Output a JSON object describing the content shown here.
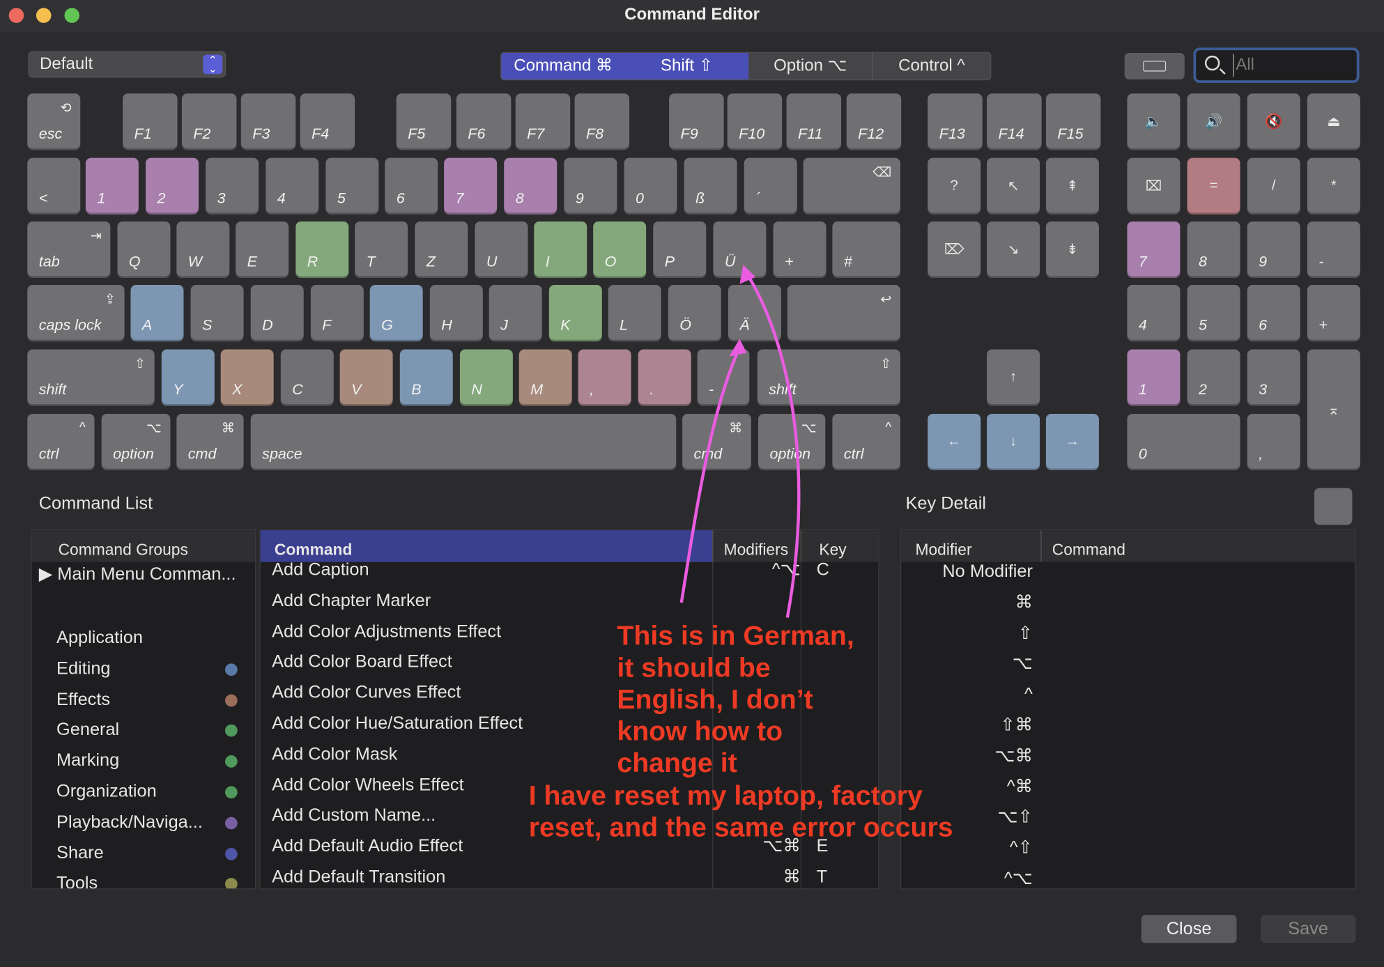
{
  "window": {
    "title": "Command Editor"
  },
  "toolbar": {
    "preset": "Default",
    "modifiers": [
      {
        "label": "Command ⌘",
        "active": true
      },
      {
        "label": "Shift ⇧",
        "active": true
      },
      {
        "label": "Option ⌥",
        "active": false
      },
      {
        "label": "Control ^",
        "active": false
      }
    ],
    "search_placeholder": "All"
  },
  "colors": {
    "purple": "#a87fad",
    "green": "#84a87b",
    "blue": "#7d97b3",
    "brown": "#a88a7c",
    "pink": "#ad8592",
    "red": "#b37b82",
    "key": "#707073",
    "accent": "#4a4fb8",
    "annotation": "#ee3a24"
  },
  "keyboard": {
    "fn_row": [
      "esc",
      "F1",
      "F2",
      "F3",
      "F4",
      "F5",
      "F6",
      "F7",
      "F8",
      "F9",
      "F10",
      "F11",
      "F12",
      "F13",
      "F14",
      "F15"
    ],
    "num_row": [
      "<",
      "1",
      "2",
      "3",
      "4",
      "5",
      "6",
      "7",
      "8",
      "9",
      "0",
      "ß",
      "´"
    ],
    "top_row": [
      "tab",
      "Q",
      "W",
      "E",
      "R",
      "T",
      "Z",
      "U",
      "I",
      "O",
      "P",
      "Ü",
      "+",
      "#"
    ],
    "home_row": [
      "caps lock",
      "A",
      "S",
      "D",
      "F",
      "G",
      "H",
      "J",
      "K",
      "L",
      "Ö",
      "Ä"
    ],
    "bottom_row": [
      "shift",
      "Y",
      "X",
      "C",
      "V",
      "B",
      "N",
      "M",
      ",",
      ".",
      "-",
      "shift"
    ],
    "space_row": [
      "ctrl",
      "option",
      "cmd",
      "space",
      "cmd",
      "option",
      "ctrl"
    ],
    "nav": [
      "?",
      "↖",
      "⇞",
      "⌦",
      "↘",
      "⇟",
      "↑",
      "←",
      "↓",
      "→"
    ],
    "numpad": [
      "⌧",
      "=",
      "/",
      "*",
      "7",
      "8",
      "9",
      "-",
      "4",
      "5",
      "6",
      "+",
      "1",
      "2",
      "3",
      "0",
      ",",
      "⌅"
    ],
    "media": [
      "🔈",
      "🔊",
      "🔇",
      "⏏"
    ]
  },
  "command_list": {
    "label": "Command List",
    "groups_header": "Command Groups",
    "groups": [
      {
        "name": "▶  Main Menu Comman..."
      },
      {
        "name": "Application"
      },
      {
        "name": "Editing",
        "color": "#5a7aa8"
      },
      {
        "name": "Effects",
        "color": "#9b6e5a"
      },
      {
        "name": "General",
        "color": "#4f9a5c"
      },
      {
        "name": "Marking",
        "color": "#4f9a5c"
      },
      {
        "name": "Organization",
        "color": "#4f9a5c"
      },
      {
        "name": "Playback/Naviga...",
        "color": "#7a5ea3"
      },
      {
        "name": "Share",
        "color": "#4f55a8"
      },
      {
        "name": "Tools",
        "color": "#8b8a4c"
      }
    ],
    "columns": [
      "Command",
      "Modifiers",
      "Key"
    ],
    "rows": [
      {
        "command": "Add Caption",
        "mods": "^⌥",
        "key": "C"
      },
      {
        "command": "Add Chapter Marker",
        "mods": "",
        "key": ""
      },
      {
        "command": "Add Color Adjustments Effect",
        "mods": "",
        "key": ""
      },
      {
        "command": "Add Color Board Effect",
        "mods": "",
        "key": ""
      },
      {
        "command": "Add Color Curves Effect",
        "mods": "",
        "key": ""
      },
      {
        "command": "Add Color Hue/Saturation Effect",
        "mods": "",
        "key": ""
      },
      {
        "command": "Add Color Mask",
        "mods": "",
        "key": ""
      },
      {
        "command": "Add Color Wheels Effect",
        "mods": "",
        "key": ""
      },
      {
        "command": "Add Custom Name...",
        "mods": "",
        "key": ""
      },
      {
        "command": "Add Default Audio Effect",
        "mods": "⌥⌘",
        "key": "E"
      },
      {
        "command": "Add Default Transition",
        "mods": "⌘",
        "key": "T"
      }
    ]
  },
  "key_detail": {
    "label": "Key Detail",
    "columns": [
      "Modifier",
      "Command"
    ],
    "rows": [
      "No Modifier",
      "⌘",
      "⇧",
      "⌥",
      "^",
      "⇧⌘",
      "⌥⌘",
      "^⌘",
      "⌥⇧",
      "^⇧",
      "^⌥"
    ]
  },
  "buttons": {
    "close": "Close",
    "save": "Save"
  },
  "annotation": {
    "lines": [
      "This is in German,",
      "it should be",
      "English, I don’t",
      "know how to",
      "change it"
    ],
    "line2": [
      "I have reset my laptop, factory",
      "reset, and the same error occurs"
    ]
  }
}
